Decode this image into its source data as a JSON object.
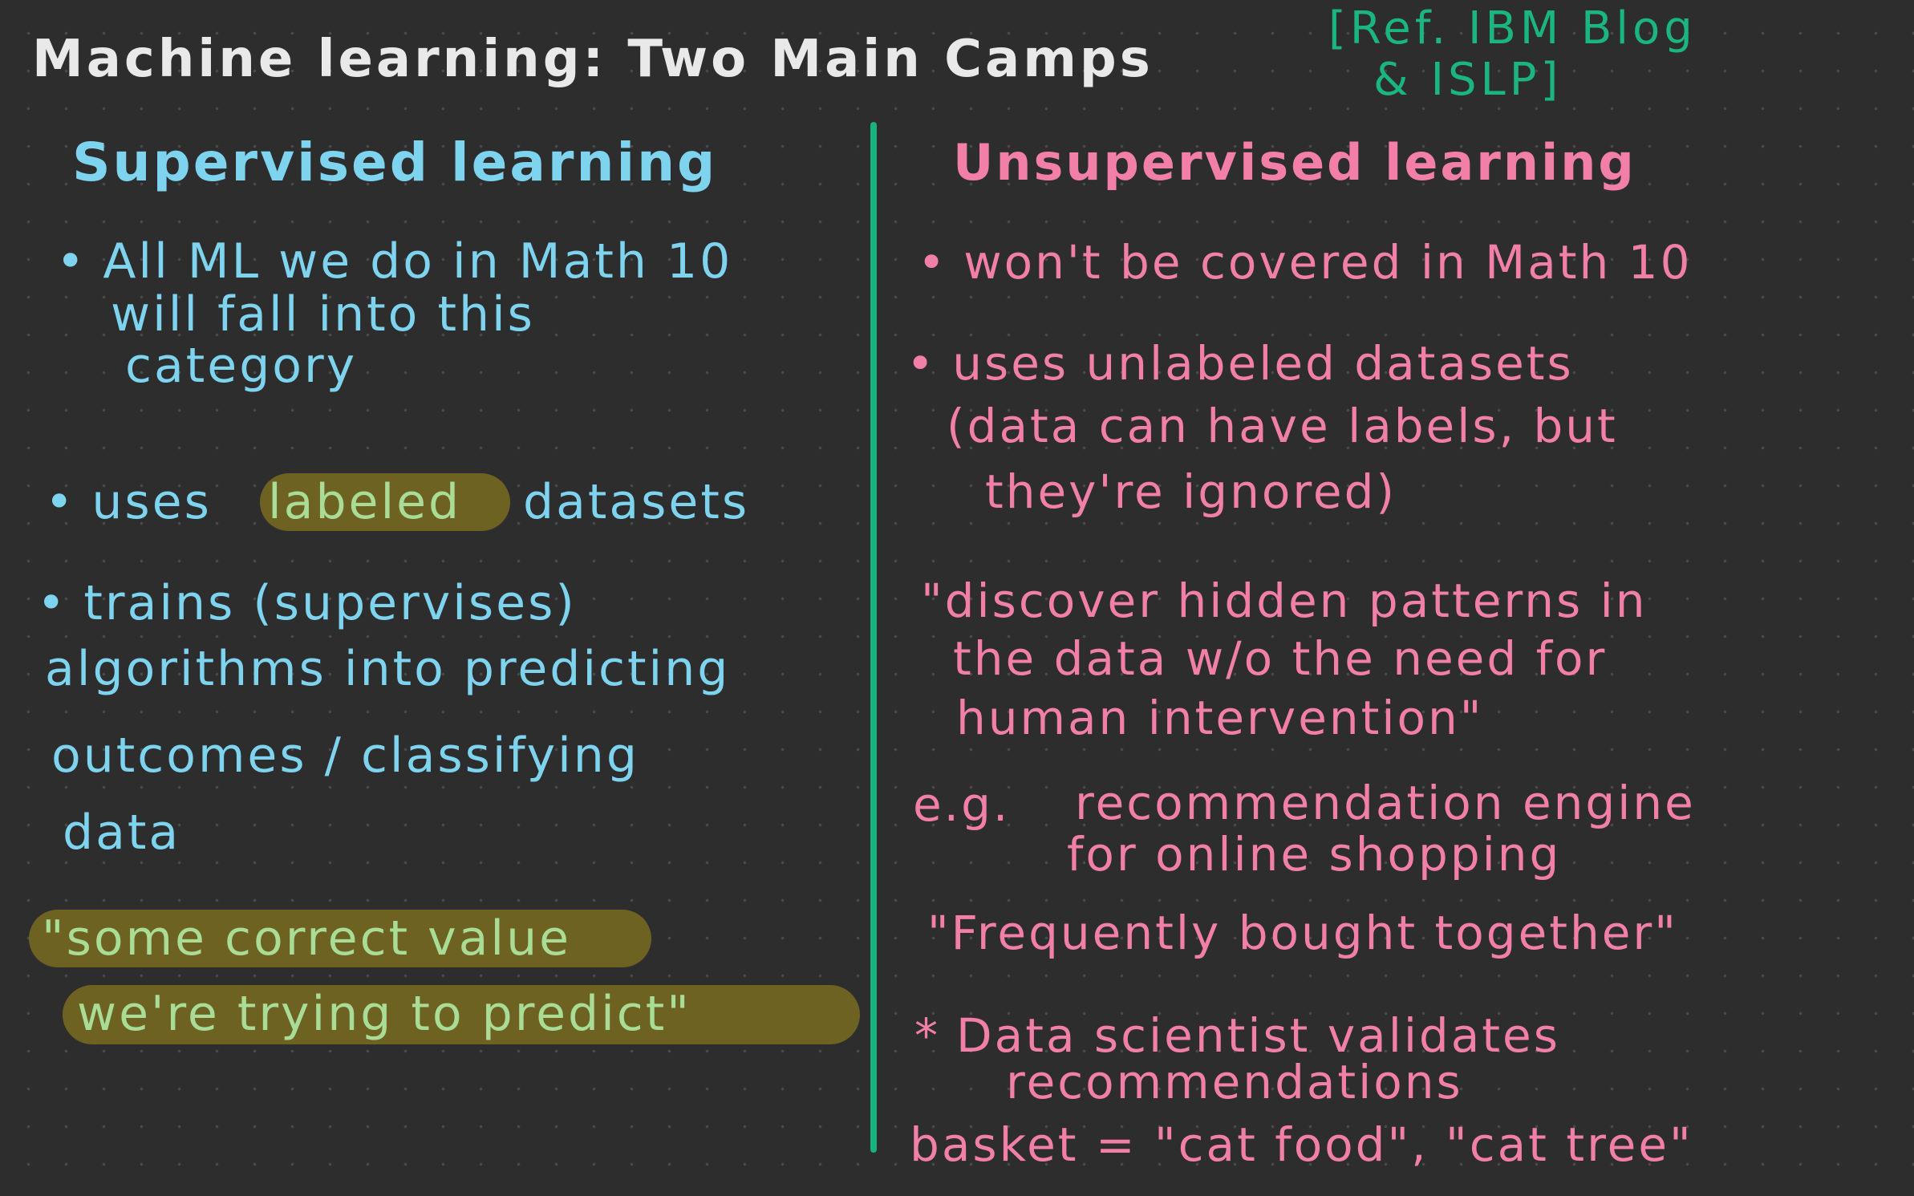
{
  "title": "Machine learning: Two Main Camps",
  "reference": {
    "line1": "[Ref. IBM Blog",
    "line2": "& ISLP]"
  },
  "supervised": {
    "heading": "Supervised learning",
    "bullet_char": "•",
    "items": [
      {
        "lines": [
          "All ML we do in Math 10",
          "will fall into this",
          "category"
        ]
      },
      {
        "prefix": "uses",
        "highlight": "labeled",
        "suffix": "datasets"
      },
      {
        "lines": [
          "trains (supervises)",
          "algorithms into predicting",
          "outcomes / classifying",
          "data"
        ]
      }
    ],
    "quote": {
      "line1": "\"some correct value",
      "line2": "we're trying to predict\""
    }
  },
  "unsupervised": {
    "heading": "Unsupervised learning",
    "bullet_char": "•",
    "items": [
      {
        "lines": [
          "won't be covered in Math 10"
        ]
      },
      {
        "lines": [
          "uses unlabeled datasets",
          "(data can have labels, but",
          "they're ignored)"
        ]
      }
    ],
    "quote": {
      "lines": [
        "\"discover hidden patterns in",
        "the data w/o the need for",
        "human intervention\""
      ]
    },
    "example": {
      "prefix": "e.g.",
      "lines": [
        "recommendation engine",
        "for online shopping"
      ]
    },
    "example_quote": "\"Frequently bought together\"",
    "note": {
      "marker": "*",
      "lines": [
        "Data scientist validates",
        "recommendations"
      ]
    },
    "basket": "basket = \"cat food\", \"cat tree\""
  },
  "colors": {
    "background": "#2d2d2e",
    "title": "#e9e9e9",
    "reference": "#1bb57f",
    "supervised": "#7ed3ee",
    "unsupervised": "#f27fa7",
    "highlight_fill": "#6e6222",
    "highlight_text": "#a9dc95",
    "divider": "#17b37d"
  }
}
